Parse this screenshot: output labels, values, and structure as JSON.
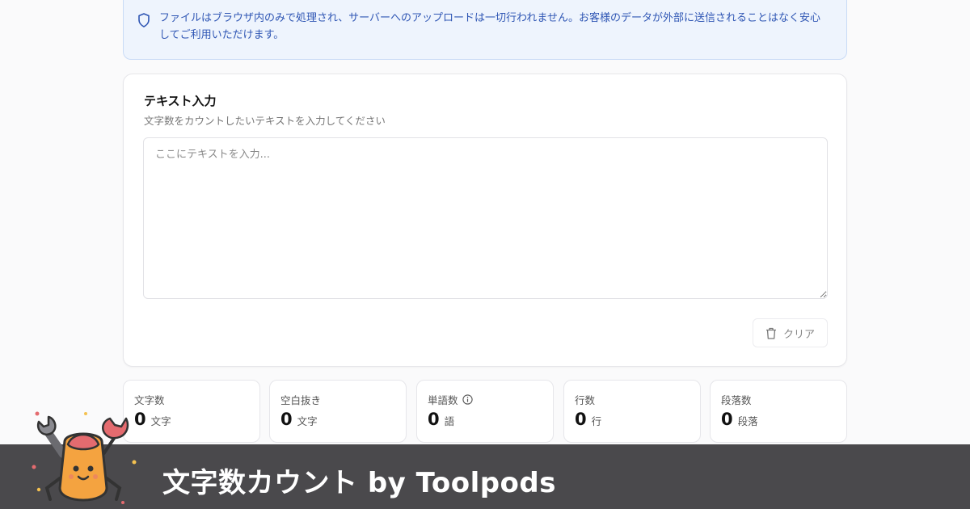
{
  "notice": {
    "icon": "shield-icon",
    "text": "ファイルはブラウザ内のみで処理され、サーバーへのアップロードは一切行われません。お客様のデータが外部に送信されることはなく安心してご利用いただけます。"
  },
  "input_card": {
    "title": "テキスト入力",
    "subtitle": "文字数をカウントしたいテキストを入力してください",
    "textarea_value": "",
    "textarea_placeholder": "ここにテキストを入力...",
    "clear_label": "クリア",
    "clear_icon": "trash-icon"
  },
  "stats": [
    {
      "label": "文字数",
      "value": "0",
      "unit": "文字"
    },
    {
      "label": "空白抜き",
      "value": "0",
      "unit": "文字"
    },
    {
      "label": "単語数",
      "value": "0",
      "unit": "語",
      "info_icon": "info-icon"
    },
    {
      "label": "行数",
      "value": "0",
      "unit": "行"
    },
    {
      "label": "段落数",
      "value": "0",
      "unit": "段落"
    }
  ],
  "footer": {
    "title": "文字数カウント by Toolpods",
    "mascot": "crab-mascot-logo"
  },
  "colors": {
    "notice_bg": "#eef4fd",
    "notice_text": "#2f56b4",
    "footer_bg": "#4a494c",
    "mascot_body": "#f4a340",
    "mascot_claws": "#e46b6f"
  }
}
